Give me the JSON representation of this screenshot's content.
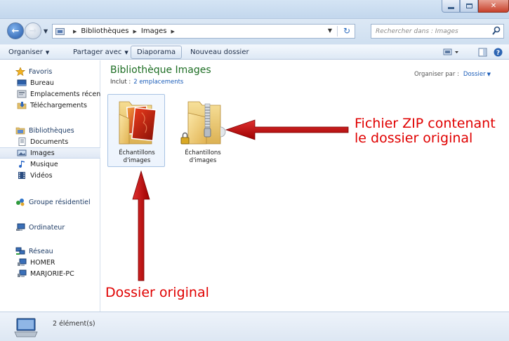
{
  "window": {
    "close_label": "✕"
  },
  "address": {
    "crumbs": [
      "Bibliothèques",
      "Images"
    ],
    "search_placeholder": "Rechercher dans : Images"
  },
  "toolbar": {
    "organize": "Organiser",
    "share": "Partager avec",
    "slideshow": "Diaporama",
    "new_folder": "Nouveau dossier"
  },
  "nav": {
    "favorites": "Favoris",
    "desktop": "Bureau",
    "recent": "Emplacements récents",
    "downloads": "Téléchargements",
    "libraries": "Bibliothèques",
    "documents": "Documents",
    "images": "Images",
    "music": "Musique",
    "videos": "Vidéos",
    "homegroup": "Groupe résidentiel",
    "computer": "Ordinateur",
    "network": "Réseau",
    "homer": "HOMER",
    "marjorie": "MARJORIE-PC"
  },
  "content": {
    "title": "Bibliothèque Images",
    "includes_label": "Inclut :",
    "includes_link": "2 emplacements",
    "arrange_label": "Organiser par :",
    "arrange_value": "Dossier",
    "items": [
      {
        "label_line1": "Échantillons",
        "label_line2": "d'images"
      },
      {
        "label_line1": "Échantillons",
        "label_line2": "d'images"
      }
    ]
  },
  "annotations": {
    "zip_line1": "Fichier ZIP contenant",
    "zip_line2": "le dossier original",
    "original": "Dossier original"
  },
  "status": {
    "count": "2 élément(s)"
  },
  "colors": {
    "annotation_red": "#e00000",
    "arrow_red": "#c00000",
    "library_green": "#1e6e24",
    "link_blue": "#1a5cb8"
  }
}
